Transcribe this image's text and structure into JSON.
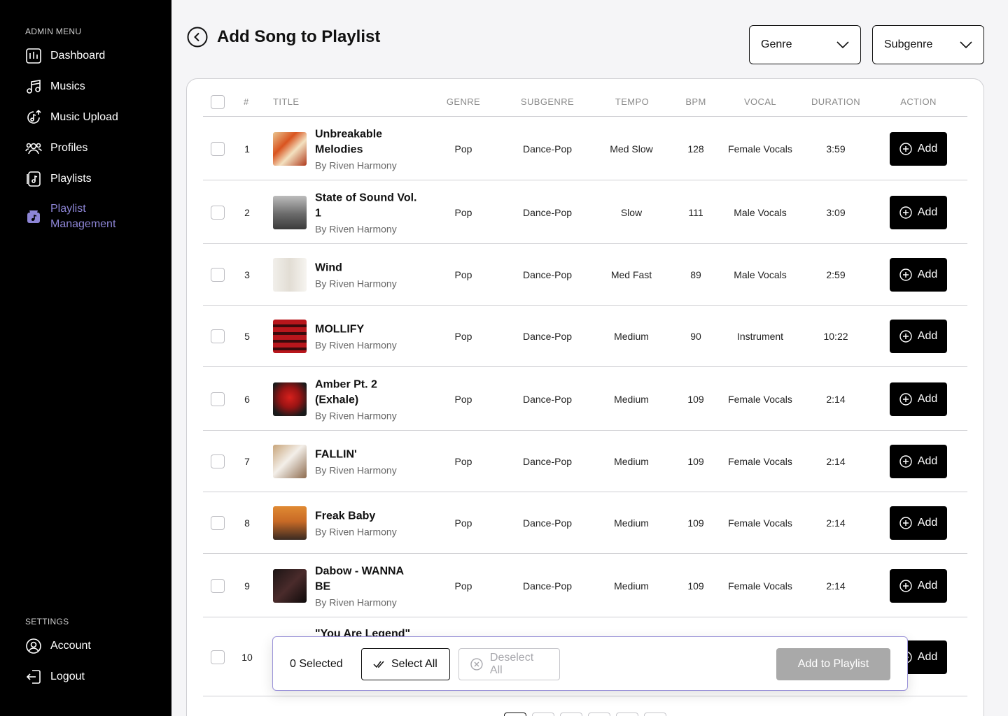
{
  "sidebar": {
    "admin_label": "ADMIN MENU",
    "items": [
      {
        "label": "Dashboard",
        "icon": "chart-icon"
      },
      {
        "label": "Musics",
        "icon": "music-notes-icon"
      },
      {
        "label": "Music Upload",
        "icon": "music-upload-icon"
      },
      {
        "label": "Profiles",
        "icon": "users-icon"
      },
      {
        "label": "Playlists",
        "icon": "playlist-icon"
      },
      {
        "label": "Playlist Management",
        "icon": "playlist-management-icon"
      }
    ],
    "active_index": 5,
    "active_color": "#8d85d6",
    "settings_label": "SETTINGS",
    "settings_items": [
      {
        "label": "Account",
        "icon": "account-icon"
      },
      {
        "label": "Logout",
        "icon": "logout-icon"
      }
    ]
  },
  "header": {
    "title": "Add Song to Playlist",
    "genre_select": "Genre",
    "subgenre_select": "Subgenre"
  },
  "table": {
    "columns": [
      "#",
      "TITLE",
      "GENRE",
      "SUBGENRE",
      "TEMPO",
      "BPM",
      "VOCAL",
      "DURATION",
      "ACTION"
    ],
    "add_label": "Add",
    "rows": [
      {
        "num": "1",
        "title": "Unbreakable Melodies",
        "artist": "By Riven Harmony",
        "genre": "Pop",
        "subgenre": "Dance-Pop",
        "tempo": "Med Slow",
        "bpm": "128",
        "vocal": "Female Vocals",
        "duration": "3:59"
      },
      {
        "num": "2",
        "title": "State of Sound Vol. 1",
        "artist": "By Riven Harmony",
        "genre": "Pop",
        "subgenre": "Dance-Pop",
        "tempo": "Slow",
        "bpm": "111",
        "vocal": "Male Vocals",
        "duration": "3:09"
      },
      {
        "num": "3",
        "title": "Wind",
        "artist": "By Riven Harmony",
        "genre": "Pop",
        "subgenre": "Dance-Pop",
        "tempo": "Med Fast",
        "bpm": "89",
        "vocal": "Male Vocals",
        "duration": "2:59"
      },
      {
        "num": "5",
        "title": "MOLLIFY",
        "artist": "By Riven Harmony",
        "genre": "Pop",
        "subgenre": "Dance-Pop",
        "tempo": "Medium",
        "bpm": "90",
        "vocal": "Instrument",
        "duration": "10:22"
      },
      {
        "num": "6",
        "title": "Amber Pt. 2 (Exhale)",
        "artist": "By Riven Harmony",
        "genre": "Pop",
        "subgenre": "Dance-Pop",
        "tempo": "Medium",
        "bpm": "109",
        "vocal": "Female Vocals",
        "duration": "2:14"
      },
      {
        "num": "7",
        "title": "FALLIN'",
        "artist": "By Riven Harmony",
        "genre": "Pop",
        "subgenre": "Dance-Pop",
        "tempo": "Medium",
        "bpm": "109",
        "vocal": "Female Vocals",
        "duration": "2:14"
      },
      {
        "num": "8",
        "title": "Freak Baby",
        "artist": "By Riven Harmony",
        "genre": "Pop",
        "subgenre": "Dance-Pop",
        "tempo": "Medium",
        "bpm": "109",
        "vocal": "Female Vocals",
        "duration": "2:14"
      },
      {
        "num": "9",
        "title": "Dabow - WANNA BE",
        "artist": "By Riven Harmony",
        "genre": "Pop",
        "subgenre": "Dance-Pop",
        "tempo": "Medium",
        "bpm": "109",
        "vocal": "Female Vocals",
        "duration": "2:14"
      },
      {
        "num": "10",
        "title": "\"You Are Legend\"",
        "artist": "",
        "genre": "",
        "subgenre": "",
        "tempo": "",
        "bpm": "",
        "vocal": "",
        "duration": ""
      }
    ]
  },
  "selection_bar": {
    "count_text": "0 Selected",
    "select_all": "Select All",
    "deselect_all": "Deselect All",
    "add_to_playlist": "Add to Playlist"
  }
}
